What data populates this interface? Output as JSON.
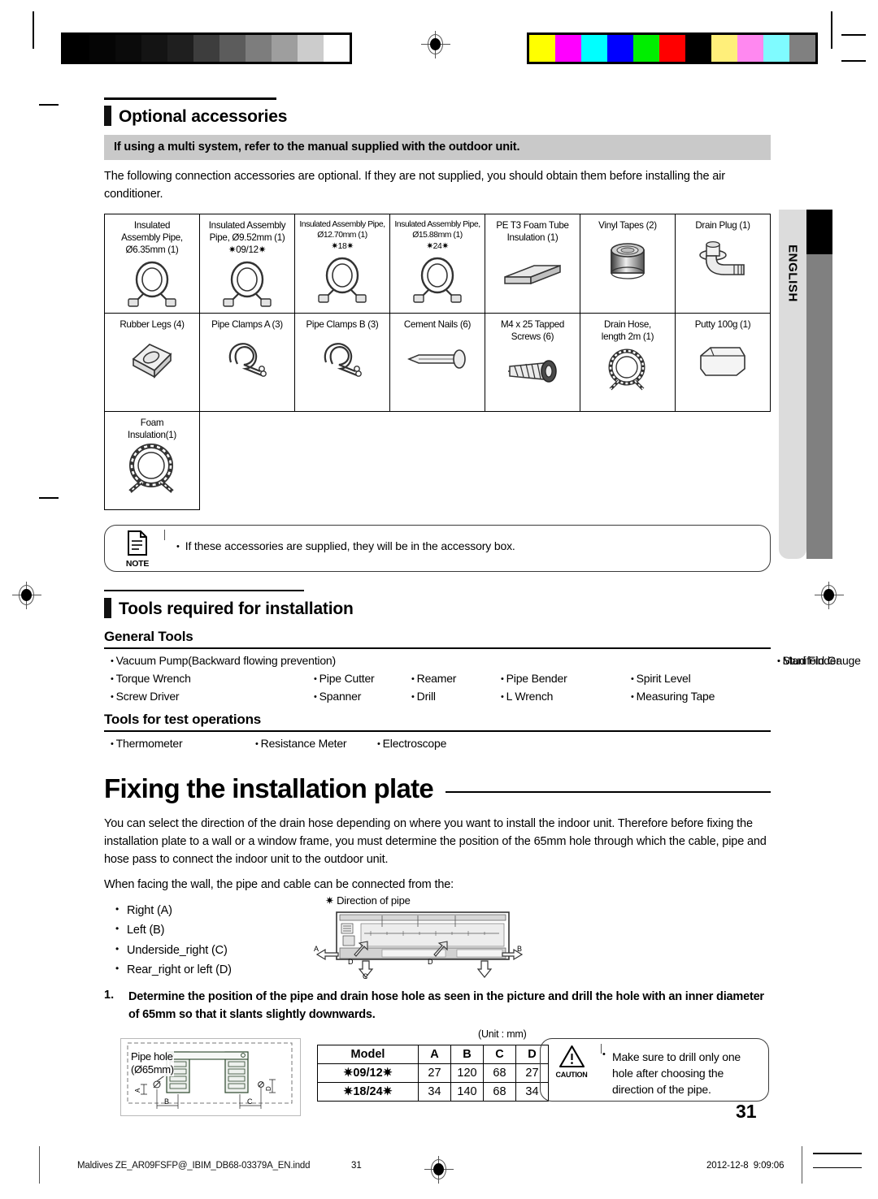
{
  "calibration": {
    "gray_steps": [
      "#000000",
      "#050505",
      "#0b0b0b",
      "#141414",
      "#1f1f1f",
      "#3d3d3d",
      "#5c5c5c",
      "#7d7d7d",
      "#9e9e9e",
      "#cccccc",
      "#ffffff"
    ],
    "color_steps": [
      "#ffff00",
      "#ff00ff",
      "#00ffff",
      "#0000ff",
      "#00ee00",
      "#ff0000",
      "#000000",
      "#ffef7a",
      "#ff88f0",
      "#7ffbff",
      "#808080"
    ]
  },
  "sections": {
    "optional_accessories": {
      "title": "Optional accessories",
      "gray_note": "If using a multi system, refer to the manual supplied with the outdoor unit.",
      "intro": "The following connection accessories are optional. If they are not supplied, you should obtain them before installing the air conditioner.",
      "table_rows": [
        [
          {
            "lines": [
              "Insulated",
              "Assembly Pipe,",
              "Ø6.35mm (1)"
            ],
            "icon": "insulated-pipe-coil-icon",
            "small": false
          },
          {
            "lines": [
              "Insulated Assembly",
              "Pipe, Ø9.52mm (1)",
              "✷09/12✷"
            ],
            "icon": "insulated-pipe-coil-icon",
            "small": false
          },
          {
            "lines": [
              "Insulated Assembly Pipe,",
              "Ø12.70mm (1)",
              "✷18✷"
            ],
            "icon": "insulated-pipe-coil-icon",
            "small": true
          },
          {
            "lines": [
              "Insulated Assembly Pipe,",
              "Ø15.88mm (1)",
              "✷24✷"
            ],
            "icon": "insulated-pipe-coil-icon",
            "small": true
          },
          {
            "lines": [
              "PE T3 Foam Tube",
              "Insulation (1)"
            ],
            "icon": "foam-sheet-icon",
            "small": false
          },
          {
            "lines": [
              "Vinyl Tapes (2)"
            ],
            "icon": "tape-roll-icon",
            "small": false
          },
          {
            "lines": [
              "Drain Plug (1)"
            ],
            "icon": "drain-plug-icon",
            "small": false
          }
        ],
        [
          {
            "lines": [
              "Rubber Legs (4)"
            ],
            "icon": "rubber-leg-icon",
            "small": false
          },
          {
            "lines": [
              "Pipe Clamps A (3)"
            ],
            "icon": "pipe-clamp-icon",
            "small": false
          },
          {
            "lines": [
              "Pipe Clamps B (3)"
            ],
            "icon": "pipe-clamp-icon",
            "small": false
          },
          {
            "lines": [
              "Cement Nails (6)"
            ],
            "icon": "nail-icon",
            "small": false
          },
          {
            "lines": [
              "M4 x 25 Tapped",
              "Screws (6)"
            ],
            "icon": "screw-icon",
            "small": false
          },
          {
            "lines": [
              "Drain Hose,",
              "length 2m (1)"
            ],
            "icon": "drain-hose-icon",
            "small": false
          },
          {
            "lines": [
              "Putty 100g (1)"
            ],
            "icon": "putty-icon",
            "small": false
          }
        ],
        [
          {
            "lines": [
              "Foam",
              "Insulation(1)"
            ],
            "icon": "foam-insulation-ring-icon",
            "small": false
          }
        ]
      ],
      "note": {
        "label": "NOTE",
        "icon": "note-document-icon",
        "text": "If these accessories are supplied, they will be in the accessory box."
      }
    },
    "tools": {
      "title": "Tools required for installation",
      "general_title": "General Tools",
      "general_rows": [
        [
          "Vacuum Pump(Backward flowing prevention)",
          "",
          "",
          "Manifold Gauge",
          "Stud Finder"
        ],
        [
          "Torque Wrench",
          "Pipe Cutter",
          "Reamer",
          "Pipe Bender",
          "Spirit Level"
        ],
        [
          "Screw Driver",
          "Spanner",
          "Drill",
          "L Wrench",
          "Measuring Tape"
        ]
      ],
      "test_title": "Tools for test operations",
      "test_rows": [
        [
          "Thermometer",
          "Resistance Meter",
          "Electroscope"
        ]
      ]
    },
    "fixing_plate": {
      "title": "Fixing the installation plate",
      "para1": "You can select the direction of the drain hose depending on where you want to install the indoor unit. Therefore before fixing the installation plate to a wall or a window frame, you must determine the position of the 65mm hole through which the cable, pipe and hose pass to connect the indoor unit to the outdoor unit.",
      "para2": "When facing the wall, the pipe and cable can be connected from the:",
      "directions": [
        "Right (A)",
        "Left (B)",
        "Underside_right (C)",
        "Rear_right or left (D)"
      ],
      "diagram_caption": "✷ Direction of pipe",
      "diagram_labels": {
        "a": "A",
        "b": "B",
        "c": "C",
        "d1": "D",
        "d2": "D"
      },
      "step": {
        "number": "1.",
        "text": "Determine the position of the pipe and drain hose hole as seen in the picture and drill the hole with an inner diameter of 65mm so that it slants slightly downwards."
      },
      "hole_diagram": {
        "label_line1": "Pipe hole",
        "label_line2": "(Ø65mm)",
        "dim_a": "A",
        "dim_b": "B",
        "dim_c": "C",
        "dim_d": "D"
      },
      "model_table": {
        "unit_label": "(Unit : mm)",
        "headers": [
          "Model",
          "A",
          "B",
          "C",
          "D"
        ],
        "rows": [
          [
            "✷09/12✷",
            "27",
            "120",
            "68",
            "27"
          ],
          [
            "✷18/24✷",
            "34",
            "140",
            "68",
            "34"
          ]
        ]
      },
      "caution": {
        "label": "CAUTION",
        "icon": "warning-triangle-icon",
        "text": "Make sure to drill only one hole after choosing the direction of the pipe."
      }
    }
  },
  "side_tab": {
    "label": "ENGLISH"
  },
  "page_number": "31",
  "footer": {
    "filename": "Maldives ZE_AR09FSFP@_IBIM_DB68-03379A_EN.indd",
    "page": "31",
    "date": "2012-12-8",
    "time": "9:09:06"
  }
}
